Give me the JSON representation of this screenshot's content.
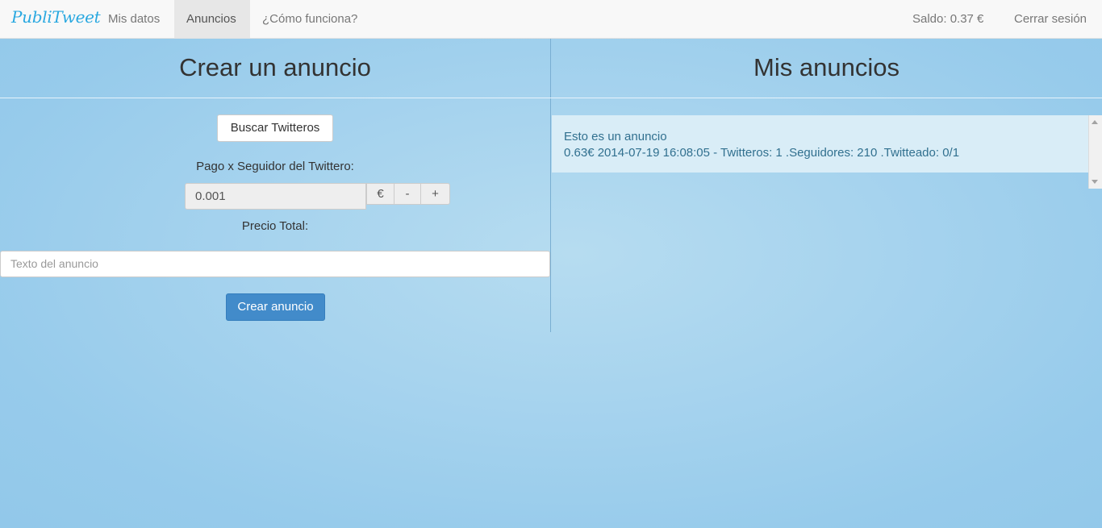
{
  "navbar": {
    "brand": "PubliTweet",
    "items": [
      {
        "label": "Mis datos",
        "active": false
      },
      {
        "label": "Anuncios",
        "active": true
      },
      {
        "label": "¿Cómo funciona?",
        "active": false
      }
    ],
    "saldo": "Saldo: 0.37 €",
    "logout": "Cerrar sesión"
  },
  "crear": {
    "title": "Crear un anuncio",
    "buscar_button": "Buscar Twitteros",
    "pago_label": "Pago x Seguidor del Twittero:",
    "pago_value": "0.001",
    "currency": "€",
    "minus": "-",
    "plus": "+",
    "precio_total_label": "Precio Total:",
    "texto_placeholder": "Texto del anuncio",
    "crear_button": "Crear anuncio"
  },
  "mis": {
    "title": "Mis anuncios",
    "ads": [
      {
        "text": "Esto es un anuncio",
        "details": "0.63€ 2014-07-19 16:08:05 - Twitteros: 1 .Seguidores: 210 .Twitteado: 0/1"
      }
    ]
  },
  "colors": {
    "brand": "#29a8e0",
    "primary": "#428bca",
    "ad_bg": "#d9edf7",
    "ad_text": "#31708f"
  }
}
